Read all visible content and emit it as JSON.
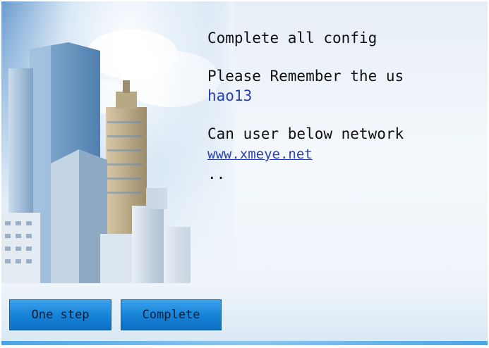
{
  "content": {
    "title": "Complete all config",
    "remember_text": "Please Remember the us",
    "username": "hao13",
    "network_text": "Can user below network",
    "link": "www.xmeye.net",
    "ellipsis": ".."
  },
  "buttons": {
    "one_step_label": "One step",
    "complete_label": "Complete"
  },
  "colors": {
    "button": "#1682d6",
    "link": "#2a3fb0",
    "text": "#111111"
  },
  "icons": [
    "city-skyline-image"
  ]
}
